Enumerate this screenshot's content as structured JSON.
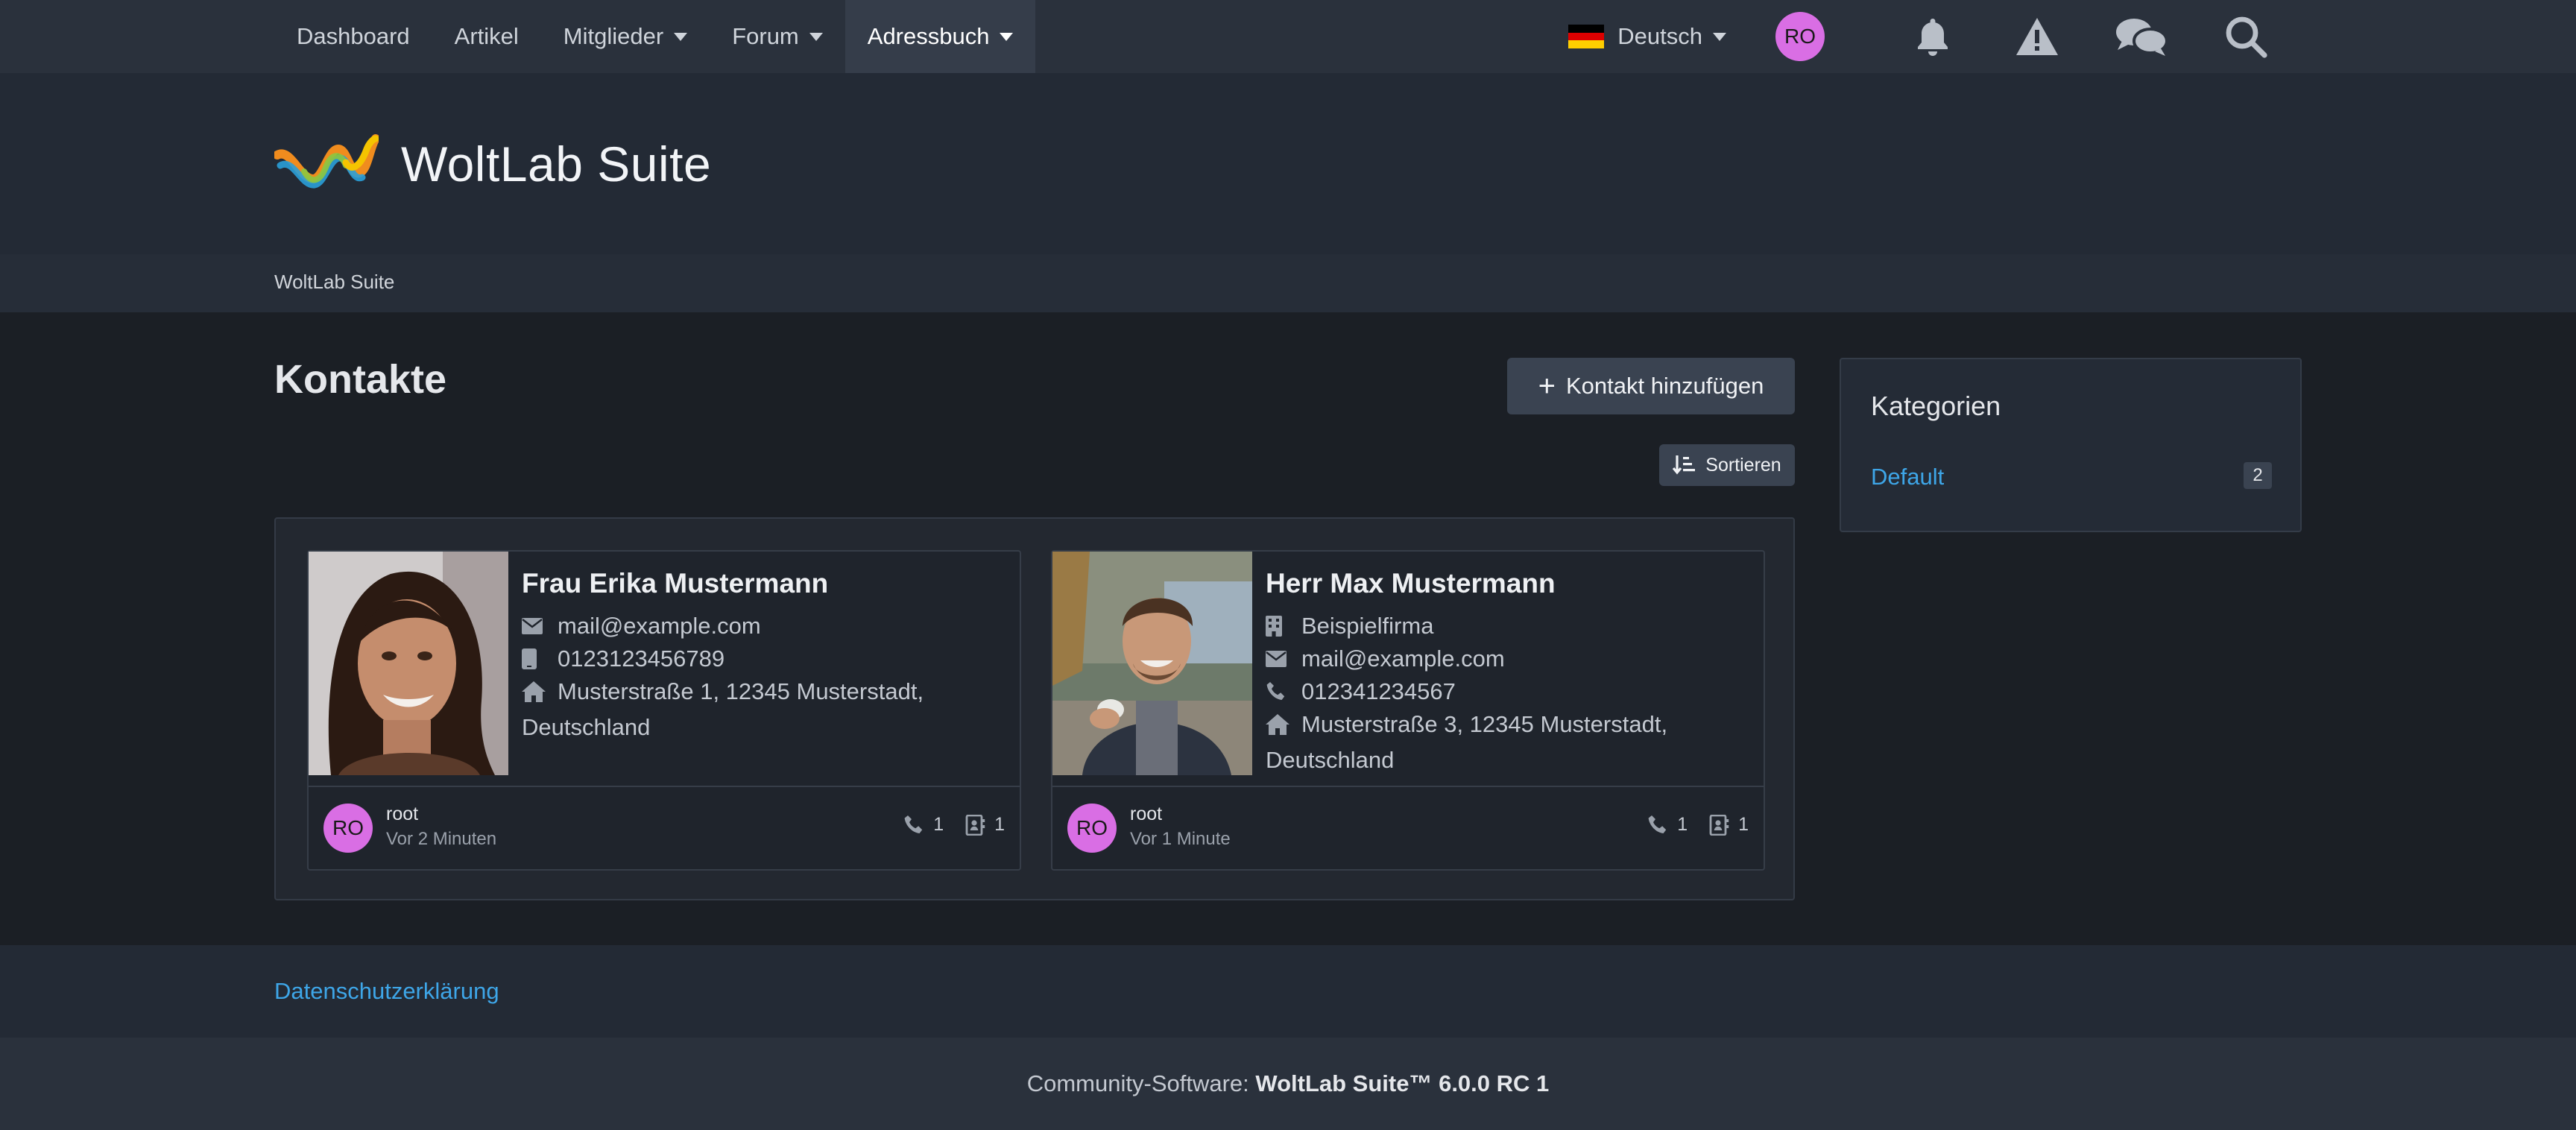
{
  "nav": {
    "items": [
      {
        "label": "Dashboard",
        "dropdown": false,
        "active": false
      },
      {
        "label": "Artikel",
        "dropdown": false,
        "active": false
      },
      {
        "label": "Mitglieder",
        "dropdown": true,
        "active": false
      },
      {
        "label": "Forum",
        "dropdown": true,
        "active": false
      },
      {
        "label": "Adressbuch",
        "dropdown": true,
        "active": true
      }
    ],
    "language": "Deutsch",
    "user_initials": "RO",
    "icons": [
      "bell-icon",
      "warning-icon",
      "chat-icon",
      "search-icon"
    ]
  },
  "header": {
    "logo_text": "WoltLab Suite",
    "breadcrumb": "WoltLab Suite"
  },
  "main": {
    "title": "Kontakte",
    "add_button": "Kontakt hinzufügen",
    "sort_button": "Sortieren",
    "contacts": [
      {
        "name": "Frau Erika Mustermann",
        "email": "mail@example.com",
        "phone": "0123123456789",
        "address": "Musterstraße 1, 12345 Musterstadt, Deutschland",
        "user": "root",
        "user_initials": "RO",
        "time": "Vor 2 Minuten",
        "phone_count": "1",
        "contact_count": "1"
      },
      {
        "name": "Herr Max Mustermann",
        "company": "Beispielfirma",
        "email": "mail@example.com",
        "phone": "012341234567",
        "address": "Musterstraße 3, 12345 Musterstadt, Deutschland",
        "user": "root",
        "user_initials": "RO",
        "time": "Vor 1 Minute",
        "phone_count": "1",
        "contact_count": "1"
      }
    ]
  },
  "sidebar": {
    "title": "Kategorien",
    "categories": [
      {
        "label": "Default",
        "count": "2"
      }
    ]
  },
  "footer": {
    "privacy_link": "Datenschutzerklärung",
    "copyright_prefix": "Community-Software: ",
    "copyright_product": "WoltLab Suite™ 6.0.0 RC 1"
  },
  "colors": {
    "accent": "#3ea6e8",
    "avatar": "#d96ee4",
    "background": "#1b1f25"
  }
}
